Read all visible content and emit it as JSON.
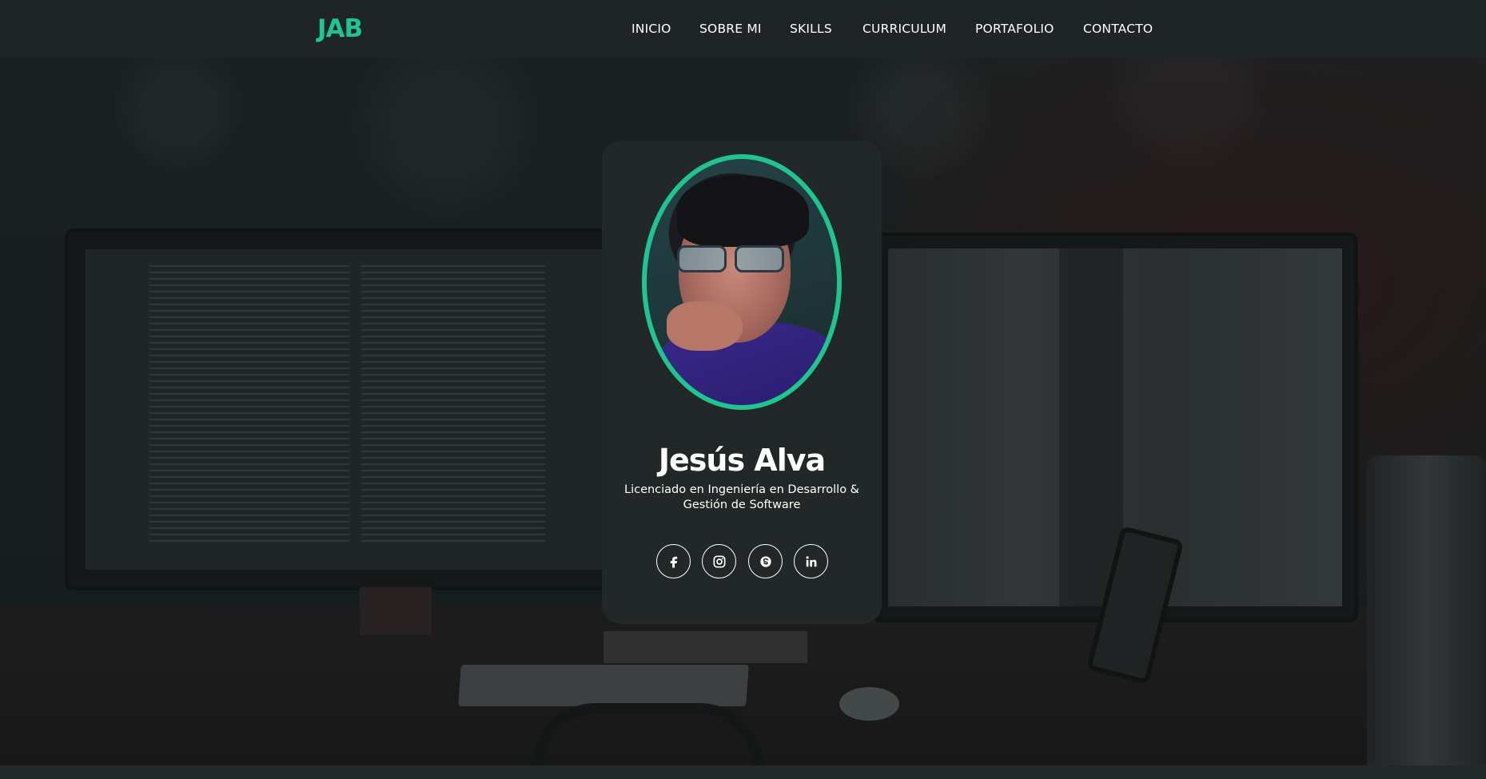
{
  "brand": {
    "logo_text": "JAB",
    "accent_color": "#1fc48e"
  },
  "nav": {
    "items": [
      {
        "label": "INICIO"
      },
      {
        "label": "SOBRE MI"
      },
      {
        "label": "SKILLS"
      },
      {
        "label": "CURRICULUM"
      },
      {
        "label": "PORTAFOLIO"
      },
      {
        "label": "CONTACTO"
      }
    ]
  },
  "profile": {
    "name": "Jesús Alva",
    "title": "Licenciado en Ingeniería en Desarrollo & Gestión de Software",
    "socials": [
      {
        "icon": "facebook-icon"
      },
      {
        "icon": "instagram-icon"
      },
      {
        "icon": "skype-icon"
      },
      {
        "icon": "linkedin-icon"
      }
    ]
  }
}
